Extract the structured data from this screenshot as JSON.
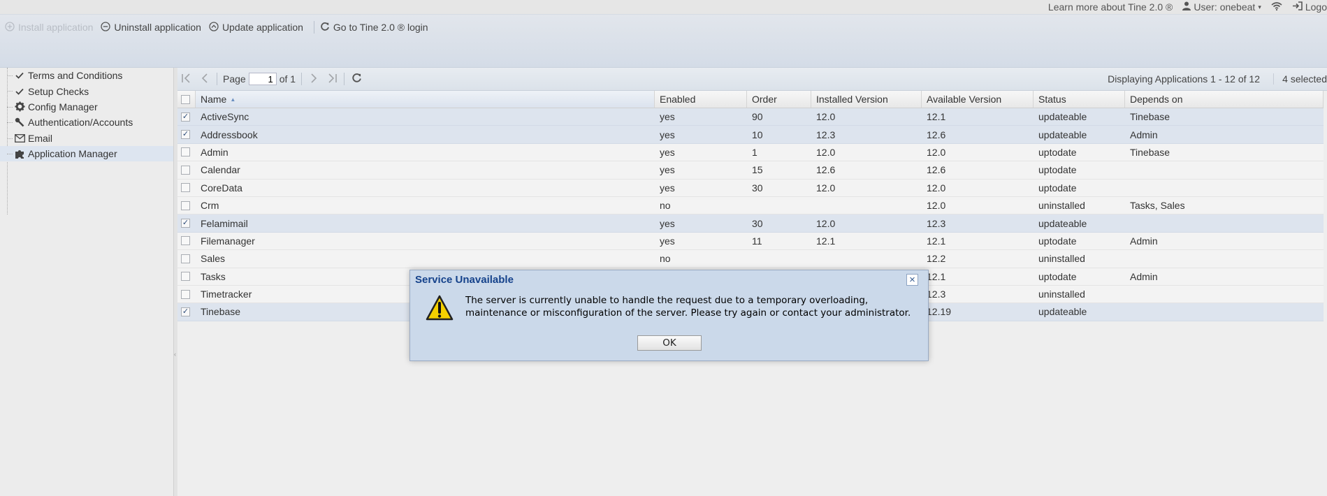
{
  "topbar": {
    "learn_more": "Learn more about Tine 2.0 ®",
    "user": "User: onebeat",
    "logout": "Logo"
  },
  "toolbar": {
    "install": "Install application",
    "uninstall": "Uninstall application",
    "update": "Update application",
    "login": "Go to Tine 2.0 ® login"
  },
  "sidebar": {
    "items": [
      {
        "label": "Terms and Conditions",
        "icon": "check-icon"
      },
      {
        "label": "Setup Checks",
        "icon": "check-icon"
      },
      {
        "label": "Config Manager",
        "icon": "gear-icon"
      },
      {
        "label": "Authentication/Accounts",
        "icon": "wrench-icon"
      },
      {
        "label": "Email",
        "icon": "envelope-icon"
      },
      {
        "label": "Application Manager",
        "icon": "puzzle-icon",
        "selected": true
      }
    ]
  },
  "pager": {
    "page_label": "Page",
    "page_value": "1",
    "of_label": "of 1",
    "display_info": "Displaying Applications 1 - 12 of 12",
    "selected_info": "4 selected"
  },
  "grid": {
    "columns": [
      "Name",
      "Enabled",
      "Order",
      "Installed Version",
      "Available Version",
      "Status",
      "Depends on"
    ],
    "rows": [
      {
        "checked": true,
        "cells": [
          "ActiveSync",
          "yes",
          "90",
          "12.0",
          "12.1",
          "updateable",
          "Tinebase"
        ]
      },
      {
        "checked": true,
        "cells": [
          "Addressbook",
          "yes",
          "10",
          "12.3",
          "12.6",
          "updateable",
          "Admin"
        ]
      },
      {
        "checked": false,
        "cells": [
          "Admin",
          "yes",
          "1",
          "12.0",
          "12.0",
          "uptodate",
          "Tinebase"
        ]
      },
      {
        "checked": false,
        "cells": [
          "Calendar",
          "yes",
          "15",
          "12.6",
          "12.6",
          "uptodate",
          ""
        ]
      },
      {
        "checked": false,
        "cells": [
          "CoreData",
          "yes",
          "30",
          "12.0",
          "12.0",
          "uptodate",
          ""
        ]
      },
      {
        "checked": false,
        "cells": [
          "Crm",
          "no",
          "",
          "",
          "12.0",
          "uninstalled",
          "Tasks, Sales"
        ]
      },
      {
        "checked": true,
        "cells": [
          "Felamimail",
          "yes",
          "30",
          "12.0",
          "12.3",
          "updateable",
          ""
        ]
      },
      {
        "checked": false,
        "cells": [
          "Filemanager",
          "yes",
          "11",
          "12.1",
          "12.1",
          "uptodate",
          "Admin"
        ]
      },
      {
        "checked": false,
        "cells": [
          "Sales",
          "no",
          "",
          "",
          "12.2",
          "uninstalled",
          ""
        ]
      },
      {
        "checked": false,
        "cells": [
          "Tasks",
          "",
          "",
          "",
          "12.1",
          "uptodate",
          "Admin"
        ]
      },
      {
        "checked": false,
        "cells": [
          "Timetracker",
          "",
          "",
          "",
          "12.3",
          "uninstalled",
          ""
        ]
      },
      {
        "checked": true,
        "cells": [
          "Tinebase",
          "",
          "",
          "",
          "12.19",
          "updateable",
          ""
        ]
      }
    ]
  },
  "dialog": {
    "title": "Service Unavailable",
    "message_line1": "The server is currently unable to handle the request due to a temporary overloading,",
    "message_line2": "maintenance or misconfiguration of the server. Please try again or contact your administrator.",
    "ok": "OK"
  },
  "colors": {
    "accent": "#15428b",
    "selection": "#dde4ee",
    "dialog_bg": "#cbd9ea",
    "warning": "#f5d000"
  }
}
